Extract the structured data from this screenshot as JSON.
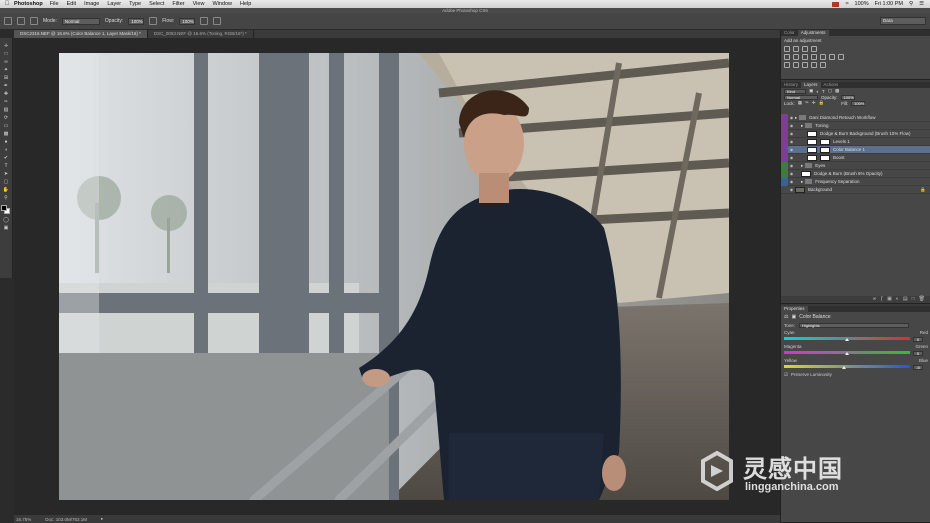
{
  "menubar": {
    "app": "Photoshop",
    "items": [
      "File",
      "Edit",
      "Image",
      "Layer",
      "Type",
      "Select",
      "Filter",
      "View",
      "Window",
      "Help"
    ],
    "clock": "Fri 1:00 PM",
    "battery": "100%"
  },
  "window": {
    "title": "Adobe Photoshop CS6"
  },
  "options": {
    "mode_label": "Mode:",
    "mode_value": "Normal",
    "opacity_label": "Opacity:",
    "opacity_value": "100%",
    "flow_label": "Flow:",
    "flow_value": "100%",
    "workspace": "Dara"
  },
  "tabs": [
    {
      "label": "DSC2316.NEF @ 16.6% (Color Balance 1, Layer Mask/16) *"
    },
    {
      "label": "DSC_0053.NEF @ 16.6% (Toning, RGB/16*) *"
    }
  ],
  "status": {
    "zoom": "16.75%",
    "doc": "Doc: 103.0M/763.1M"
  },
  "adjustments": {
    "tabs": [
      "Color",
      "Adjustments"
    ],
    "title": "Add an adjustment"
  },
  "layers_panel": {
    "tabs": [
      "History",
      "Layers",
      "Actions"
    ],
    "kind": "Kind",
    "blend": "Normal",
    "opacity_label": "Opacity:",
    "opacity": "100%",
    "lock_label": "Lock:",
    "fill_label": "Fill:",
    "fill": "100%",
    "layers": [
      {
        "name": "Dani Diamond Retouch Workflow",
        "color": "#7b3f9a",
        "type": "group",
        "indent": 0,
        "selected": false
      },
      {
        "name": "Toning",
        "color": "#7b3f9a",
        "type": "group",
        "indent": 1,
        "selected": false
      },
      {
        "name": "Dodge & Burn Background (Brush 10% Flow)",
        "color": "#7b3f9a",
        "type": "layer",
        "indent": 2,
        "selected": false
      },
      {
        "name": "Levels 1",
        "color": "#7b3f9a",
        "type": "adjust",
        "indent": 2,
        "selected": false
      },
      {
        "name": "Color Balance 1",
        "color": "#7b3f9a",
        "type": "adjust",
        "indent": 2,
        "selected": true
      },
      {
        "name": "Boost",
        "color": "#7b3f9a",
        "type": "adjust",
        "indent": 2,
        "selected": false
      },
      {
        "name": "Eyes",
        "color": "#3f7a3f",
        "type": "group",
        "indent": 1,
        "selected": false
      },
      {
        "name": "Dodge & Burn (Brush 6% Opacity)",
        "color": "#3f7a3f",
        "type": "layer",
        "indent": 1,
        "selected": false
      },
      {
        "name": "Frequency Separation",
        "color": "#3f5f9a",
        "type": "group",
        "indent": 1,
        "selected": false
      },
      {
        "name": "Background",
        "color": "",
        "type": "bg",
        "indent": 0,
        "selected": false
      }
    ]
  },
  "properties": {
    "tabs": [
      "Properties"
    ],
    "title": "Color Balance",
    "tone_label": "Tone:",
    "tone_value": "Highlights",
    "sliders": [
      {
        "left": "Cyan",
        "right": "Red",
        "value": "0",
        "pos": 0.5
      },
      {
        "left": "Magenta",
        "right": "Green",
        "value": "0",
        "pos": 0.5
      },
      {
        "left": "Yellow",
        "right": "Blue",
        "value": "-5",
        "pos": 0.48
      }
    ],
    "preserve": "Preserve Luminosity"
  },
  "watermark": {
    "brand": "灵感中国",
    "domain": "lingganchina.com"
  }
}
